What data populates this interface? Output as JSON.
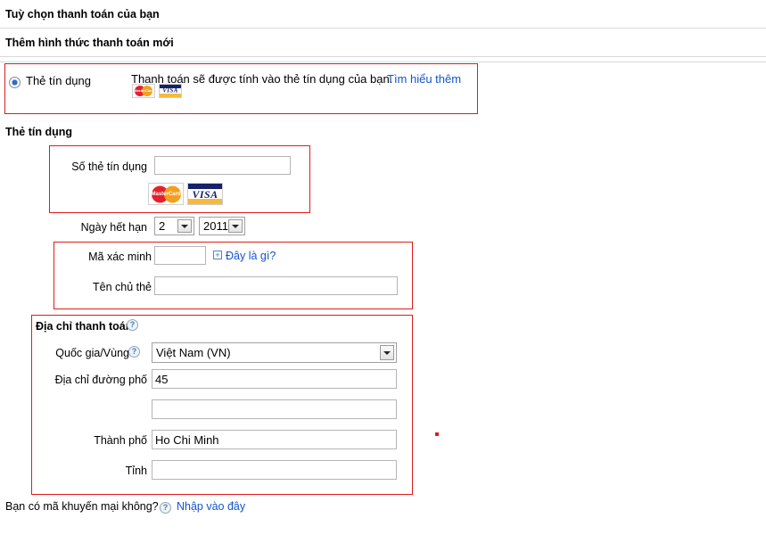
{
  "page": {
    "header_title": "Tuỳ chọn thanh toán của bạn",
    "section_title": "Thêm hình thức thanh toán mới"
  },
  "payment_method": {
    "radio_label": "Thẻ tín dụng",
    "description": "Thanh toán sẽ được tính vào thẻ tín dụng của bạn.",
    "learn_more_link": "Tìm hiểu thêm",
    "brand_mastercard": "MasterCard",
    "brand_visa": "VISA"
  },
  "credit_card": {
    "section_label": "Thẻ tín dụng",
    "card_number_label": "Số thẻ tín dụng",
    "card_number_value": "",
    "expiry_label": "Ngày hết hạn",
    "expiry_month_value": "2",
    "expiry_year_value": "2011",
    "verification_label": "Mã xác minh",
    "verification_value": "",
    "what_is_this_link": "Đây là gì?",
    "what_is_this_icon": "plus-box-icon",
    "cardholder_label": "Tên chủ thẻ",
    "cardholder_value": ""
  },
  "billing_address": {
    "section_label": "Địa chỉ thanh toán",
    "country_label": "Quốc gia/Vùng",
    "country_value": "Việt Nam (VN)",
    "street_label": "Địa chỉ đường phố",
    "street_value": "45",
    "street2_value": "",
    "city_label": "Thành phố",
    "city_value": "Ho Chi Minh",
    "state_label": "Tỉnh",
    "state_value": "",
    "help_icon": "question-mark-icon"
  },
  "promo": {
    "question": "Bạn có mã khuyến mại không?",
    "link": "Nhập vào đây",
    "help_icon": "question-mark-icon"
  },
  "colors": {
    "highlight_border": "#e01b1b",
    "link": "#1155cc",
    "field_border": "#b5b5b5",
    "divider": "#d9d9d9"
  }
}
